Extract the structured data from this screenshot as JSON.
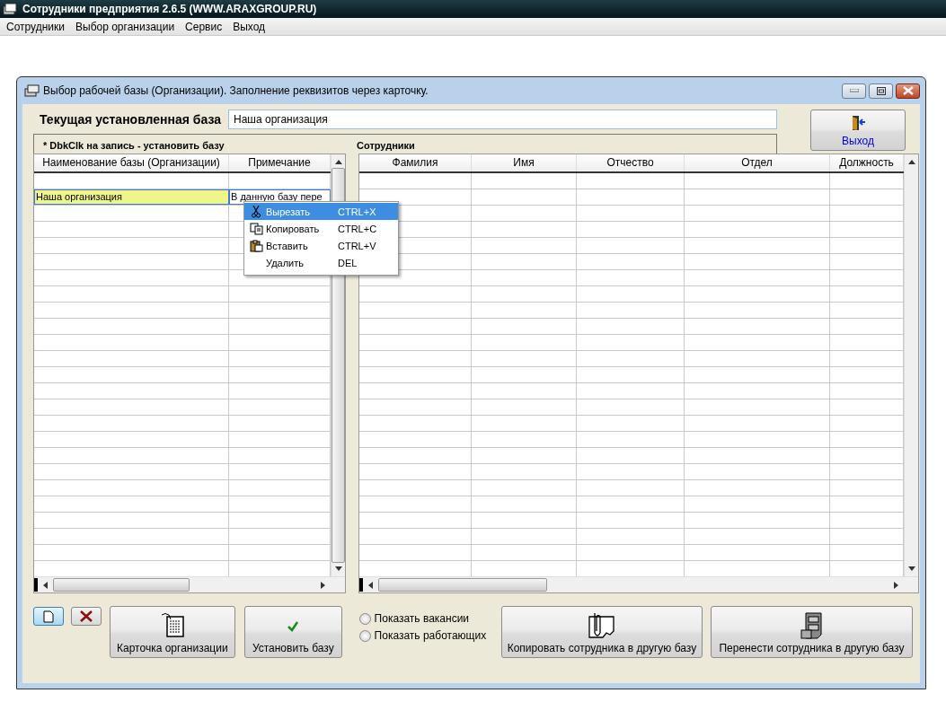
{
  "app_title": "Сотрудники предприятия 2.6.5  (WWW.ARAXGROUP.RU)",
  "menu": [
    "Сотрудники",
    "Выбор организации",
    "Сервис",
    "Выход"
  ],
  "window": {
    "title": "Выбор рабочей базы (Организации). Заполнение реквизитов через карточку."
  },
  "current_base": {
    "label": "Текущая установленная база",
    "value": "Наша организация"
  },
  "exit_button": "Выход",
  "bases_panel": {
    "caption": "*  DbkClk на запись - установить базу",
    "columns": [
      "Наименование базы (Организации)",
      "Примечание"
    ],
    "rows": [
      {
        "name": "Наша организация",
        "note": "В данную базу пере",
        "selected": true
      }
    ]
  },
  "employees_panel": {
    "caption": "Сотрудники",
    "columns": [
      "Фамилия",
      "Имя",
      "Отчество",
      "Отдел",
      "Должность"
    ]
  },
  "context_menu": [
    {
      "label": "Вырезать",
      "shortcut": "CTRL+X",
      "kind": "cut",
      "selected": true
    },
    {
      "label": "Копировать",
      "shortcut": "CTRL+C",
      "kind": "copy",
      "selected": false
    },
    {
      "label": "Вставить",
      "shortcut": "CTRL+V",
      "kind": "paste",
      "selected": false
    },
    {
      "label": "Удалить",
      "shortcut": "DEL",
      "kind": "delete",
      "selected": false
    }
  ],
  "buttons": {
    "card": "Карточка организации",
    "set_base": "Установить базу",
    "copy_employee": "Копировать сотрудника в другую базу",
    "move_employee": "Перенести сотрудника в другую базу"
  },
  "radios": [
    {
      "label": "Показать вакансии",
      "selected": false
    },
    {
      "label": "Показать работающих",
      "selected": false
    }
  ]
}
